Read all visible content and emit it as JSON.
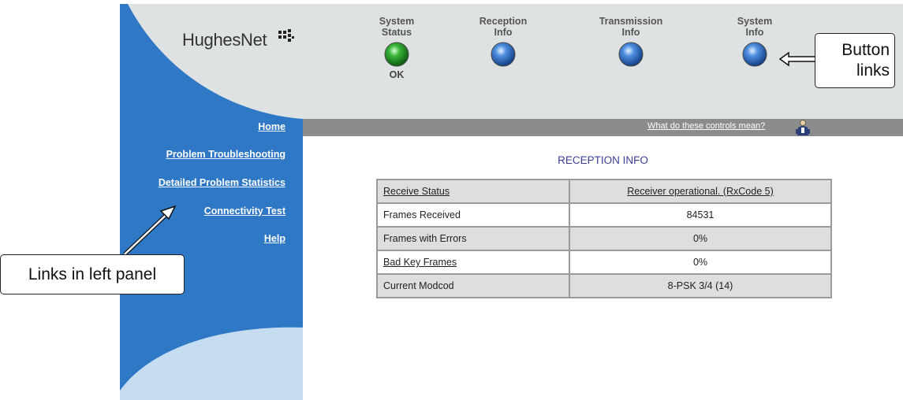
{
  "brand": {
    "logo_text": "HughesNet",
    "logo_mark": "®"
  },
  "nav_buttons": [
    {
      "line1": "System",
      "line2": "Status",
      "status": "OK",
      "orb_color": "#2fa52f"
    },
    {
      "line1": "Reception",
      "line2": "Info",
      "status": "",
      "orb_color": "#3f7fd0"
    },
    {
      "line1": "Transmission",
      "line2": "Info",
      "status": "",
      "orb_color": "#3f7fd0"
    },
    {
      "line1": "System",
      "line2": "Info",
      "status": "",
      "orb_color": "#3f7fd0"
    }
  ],
  "sidebar": {
    "links": [
      "Home",
      "Problem Troubleshooting",
      "Detailed Problem Statistics",
      "Connectivity Test",
      "Help"
    ]
  },
  "toolbar": {
    "controls_link": "What do these controls mean?",
    "helper_icon": "helper-person-icon"
  },
  "main": {
    "title": "RECEPTION INFO",
    "table": {
      "rows": [
        {
          "label": "Receive Status",
          "value": "Receiver operational. (RxCode 5)",
          "label_link": true,
          "value_link": true
        },
        {
          "label": "Frames Received",
          "value": "84531",
          "label_link": false,
          "value_link": false
        },
        {
          "label": "Frames with Errors",
          "value": "0%",
          "label_link": false,
          "value_link": false
        },
        {
          "label": "Bad Key Frames",
          "value": "0%",
          "label_link": true,
          "value_link": false
        },
        {
          "label": "Current Modcod",
          "value": "8-PSK 3/4 (14)",
          "label_link": false,
          "value_link": false
        }
      ]
    }
  },
  "callouts": {
    "buttons_line1": "Button",
    "buttons_line2": "links",
    "links_panel": "Links in left panel"
  },
  "colors": {
    "panel_blue": "#2f78c6",
    "header_grey": "#dfe2e3",
    "title_navy": "#3a3f95",
    "bar_grey": "#8c8c8c"
  }
}
